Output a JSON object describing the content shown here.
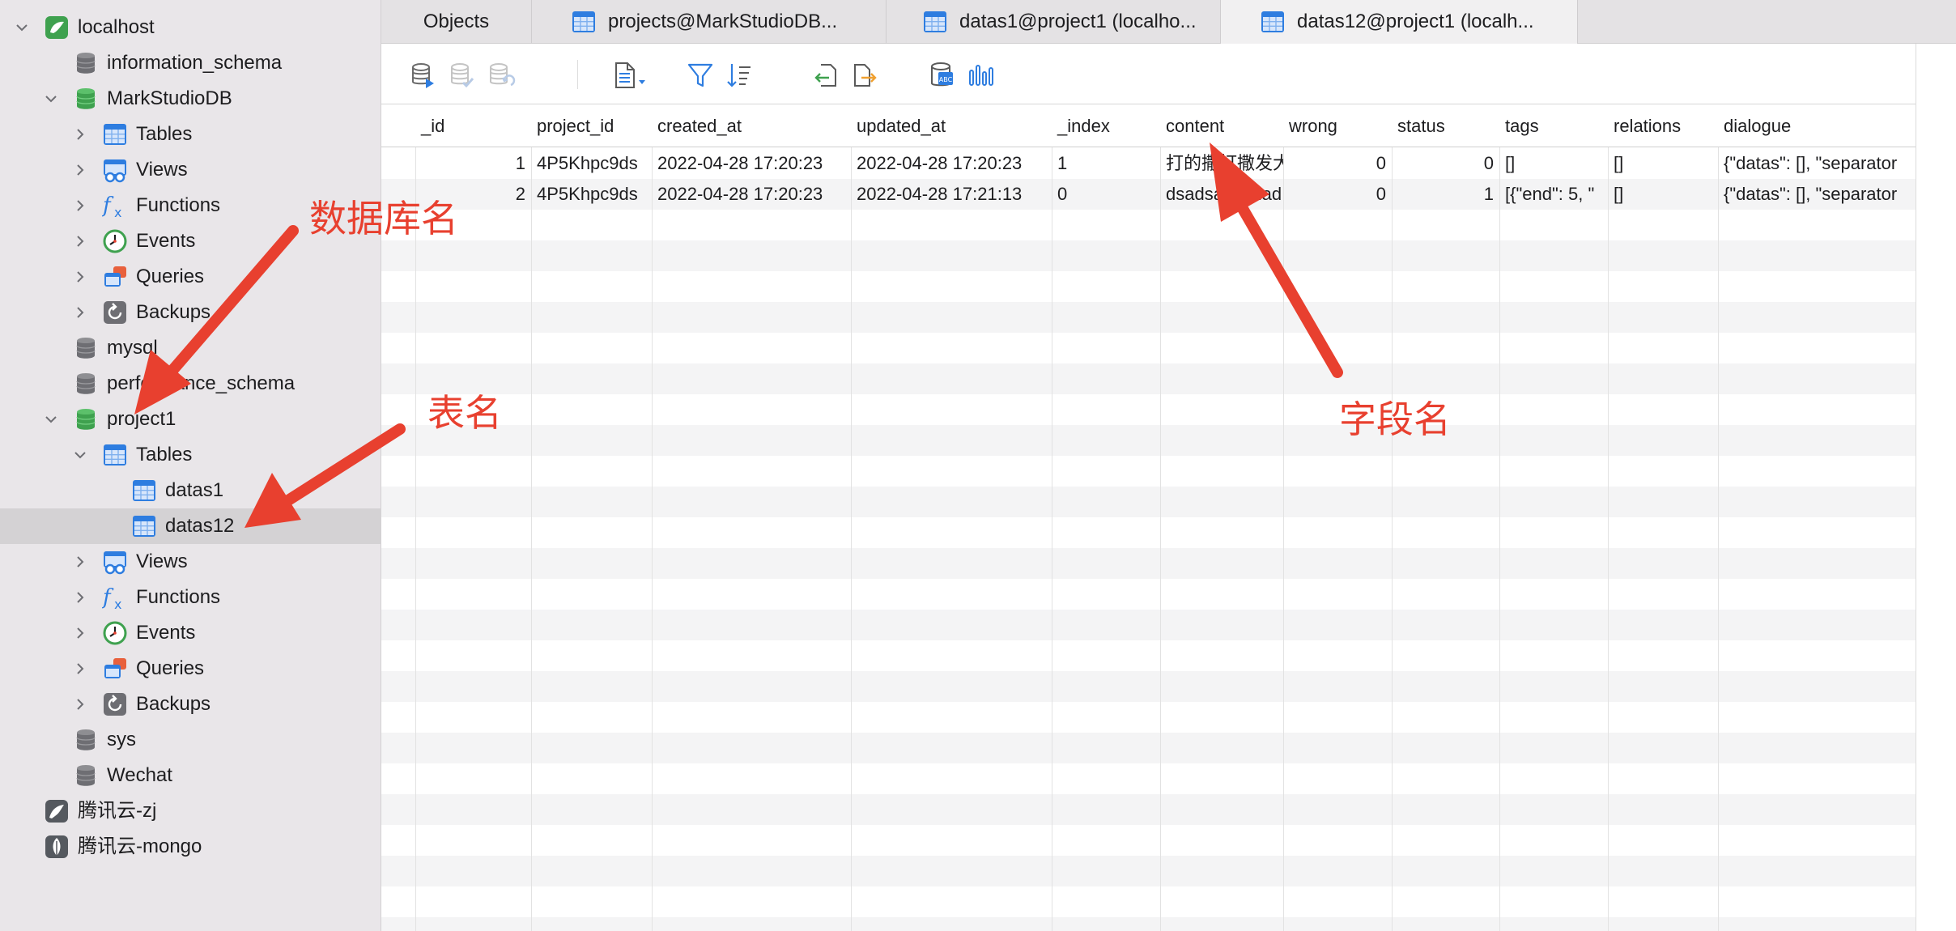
{
  "sidebar": {
    "items": [
      {
        "label": "localhost",
        "icon": "connection-icon",
        "chevron": "down"
      },
      {
        "label": "information_schema",
        "icon": "database-gray-icon",
        "chevron": ""
      },
      {
        "label": "MarkStudioDB",
        "icon": "database-green-icon",
        "chevron": "down"
      },
      {
        "label": "Tables",
        "icon": "tables-icon",
        "chevron": "right"
      },
      {
        "label": "Views",
        "icon": "views-icon",
        "chevron": "right"
      },
      {
        "label": "Functions",
        "icon": "functions-icon",
        "chevron": "right"
      },
      {
        "label": "Events",
        "icon": "events-icon",
        "chevron": "right"
      },
      {
        "label": "Queries",
        "icon": "queries-icon",
        "chevron": "right"
      },
      {
        "label": "Backups",
        "icon": "backups-icon",
        "chevron": "right"
      },
      {
        "label": "mysql",
        "icon": "database-gray-icon",
        "chevron": ""
      },
      {
        "label": "performance_schema",
        "icon": "database-gray-icon",
        "chevron": ""
      },
      {
        "label": "project1",
        "icon": "database-green-icon",
        "chevron": "down"
      },
      {
        "label": "Tables",
        "icon": "tables-icon",
        "chevron": "down"
      },
      {
        "label": "datas1",
        "icon": "table-icon",
        "chevron": ""
      },
      {
        "label": "datas12",
        "icon": "table-icon",
        "chevron": "",
        "selected": true
      },
      {
        "label": "Views",
        "icon": "views-icon",
        "chevron": "right"
      },
      {
        "label": "Functions",
        "icon": "functions-icon",
        "chevron": "right"
      },
      {
        "label": "Events",
        "icon": "events-icon",
        "chevron": "right"
      },
      {
        "label": "Queries",
        "icon": "queries-icon",
        "chevron": "right"
      },
      {
        "label": "Backups",
        "icon": "backups-icon",
        "chevron": "right"
      },
      {
        "label": "sys",
        "icon": "database-gray-icon",
        "chevron": ""
      },
      {
        "label": "Wechat",
        "icon": "database-gray-icon",
        "chevron": ""
      },
      {
        "label": "腾讯云-zj",
        "icon": "mysql-connection-icon",
        "chevron": ""
      },
      {
        "label": "腾讯云-mongo",
        "icon": "mongo-connection-icon",
        "chevron": ""
      }
    ]
  },
  "tabs": [
    {
      "label": "Objects",
      "icon": ""
    },
    {
      "label": "projects@MarkStudioDB...",
      "icon": "table-icon"
    },
    {
      "label": "datas1@project1 (localho...",
      "icon": "table-icon"
    },
    {
      "label": "datas12@project1 (localh...",
      "icon": "table-icon",
      "active": true
    }
  ],
  "toolbar": {
    "buttons": [
      {
        "name": "begin-transaction-icon",
        "enabled": true
      },
      {
        "name": "commit-icon",
        "enabled": false
      },
      {
        "name": "rollback-icon",
        "enabled": false
      },
      {
        "name": "text-view-icon",
        "enabled": true
      },
      {
        "name": "filter-icon",
        "enabled": true
      },
      {
        "name": "sort-icon",
        "enabled": true
      },
      {
        "name": "import-icon",
        "enabled": true
      },
      {
        "name": "export-icon",
        "enabled": true
      },
      {
        "name": "data-generation-icon",
        "enabled": true
      },
      {
        "name": "chart-icon",
        "enabled": true
      }
    ]
  },
  "grid": {
    "columns": [
      "_id",
      "project_id",
      "created_at",
      "updated_at",
      "_index",
      "content",
      "wrong",
      "status",
      "tags",
      "relations",
      "dialogue"
    ],
    "rows": [
      [
        "1",
        "4P5Khpc9ds",
        "2022-04-28 17:20:23",
        "2022-04-28 17:20:23",
        "1",
        "打的撒打撒发大",
        "0",
        "0",
        "[]",
        "[]",
        "{\"datas\": [], \"separator"
      ],
      [
        "2",
        "4P5Khpc9ds",
        "2022-04-28 17:20:23",
        "2022-04-28 17:21:13",
        "0",
        "dsadsadsadad",
        "0",
        "1",
        "[{\"end\": 5, \"",
        "[]",
        "{\"datas\": [], \"separator"
      ]
    ]
  },
  "annotations": {
    "db_name": "数据库名",
    "table_name": "表名",
    "field_name": "字段名",
    "color": "#e8402f"
  },
  "colors": {
    "sidebar_bg": "#e9e6e9",
    "selected_row": "#d4d2d4",
    "grid_stripe": "#f4f4f5",
    "db_green": "#3fa14f",
    "table_blue": "#2e7de0"
  }
}
